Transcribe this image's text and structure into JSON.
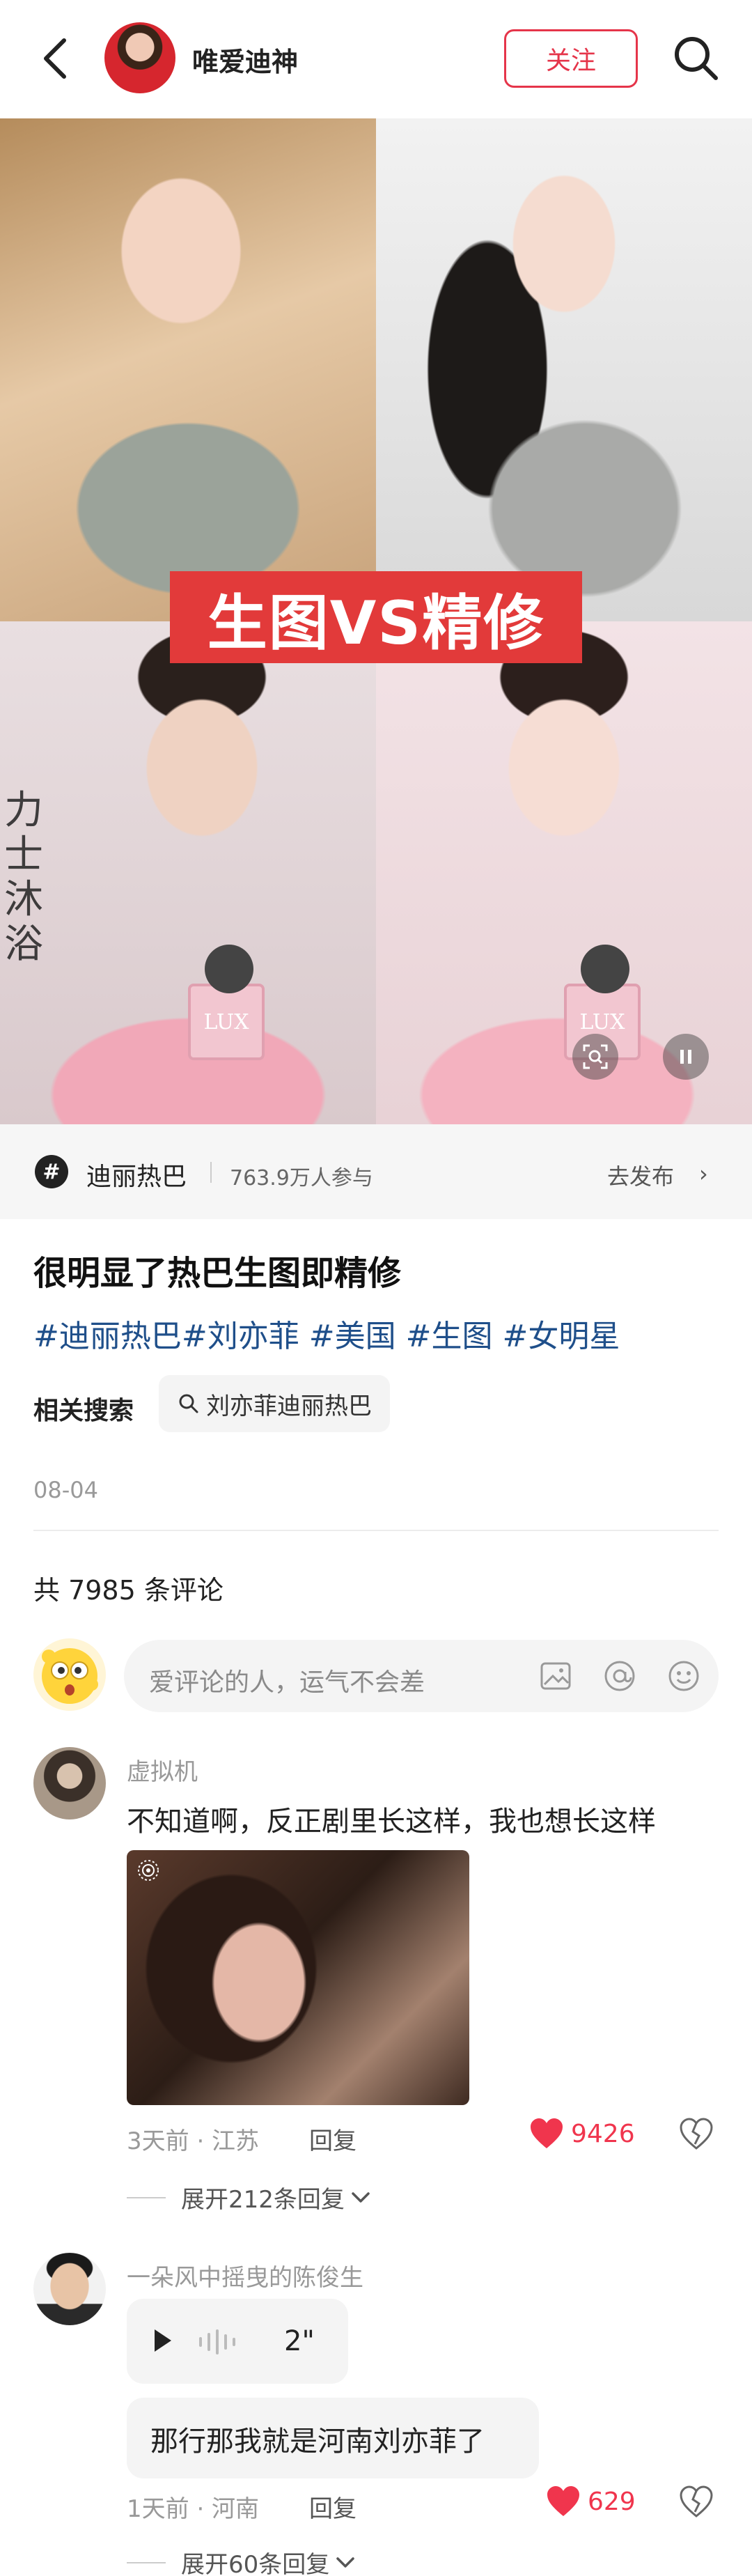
{
  "header": {
    "author_name": "唯爱迪神",
    "follow_label": "关注"
  },
  "media": {
    "banner_text": "生图VS精修",
    "side_text": "力士沐浴",
    "mic_brand": "LUX"
  },
  "topic": {
    "icon": "#",
    "name": "迪丽热巴",
    "participants": "763.9万人参与",
    "action_label": "去发布",
    "chevron": "›"
  },
  "post": {
    "title": "很明显了热巴生图即精修",
    "tags": [
      "#迪丽热巴",
      "#刘亦菲",
      " #美国",
      " #生图",
      " #女明星"
    ],
    "related_label": "相关搜索",
    "related_query": "刘亦菲迪丽热巴",
    "date": "08-04"
  },
  "comments_header": {
    "count_text": "共 7985 条评论",
    "input_placeholder": "爱评论的人，运气不会差"
  },
  "comments": [
    {
      "user": "虚拟机",
      "text": "不知道啊，反正剧里长这样，我也想长这样",
      "time_location": "3天前 · 江苏",
      "reply_label": "回复",
      "likes": "9426",
      "expand_label": "展开212条回复"
    },
    {
      "user": "一朵风中摇曳的陈俊生",
      "voice_duration": "2\"",
      "text": "那行那我就是河南刘亦菲了",
      "time_location": "1天前 · 河南",
      "reply_label": "回复",
      "likes": "629",
      "expand_label": "展开60条回复"
    }
  ],
  "colors": {
    "accent": "#e5354a",
    "tag": "#1f4f8a",
    "like": "#f0354d",
    "banner": "#e23a3a"
  },
  "icons": [
    "back-arrow-icon",
    "search-icon",
    "topic-hash-icon",
    "chevron-right-icon",
    "image-icon",
    "at-icon",
    "emoji-icon",
    "heart-icon",
    "dislike-heart-icon",
    "chevron-down-icon",
    "play-icon",
    "pause-icon",
    "screen-search-icon",
    "live-photo-icon"
  ]
}
